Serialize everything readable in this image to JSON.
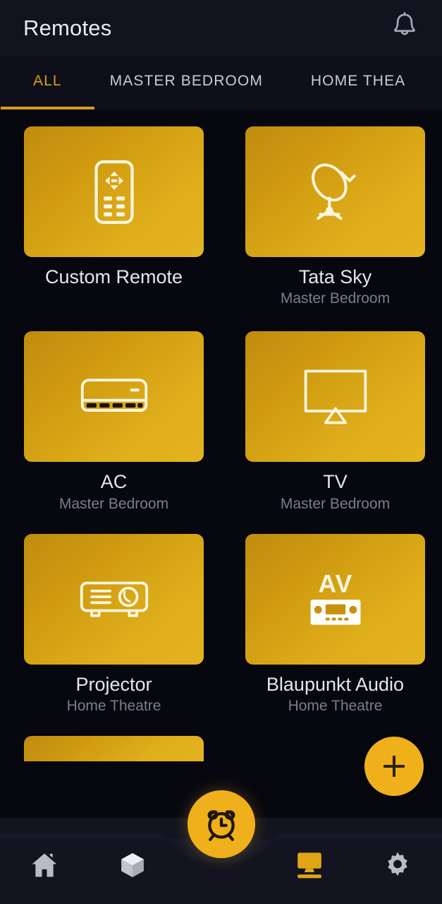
{
  "header": {
    "title": "Remotes",
    "notification_icon": "bell-icon"
  },
  "tabs": [
    {
      "label": "ALL",
      "active": true
    },
    {
      "label": "MASTER BEDROOM",
      "active": false
    },
    {
      "label": "HOME THEA",
      "active": false
    }
  ],
  "colors": {
    "accent": "#d99d18",
    "fab": "#efb01c",
    "card_gradient_start": "#c08c10",
    "card_gradient_end": "#e3b41f",
    "background": "#07070f",
    "header_bg": "#12131f",
    "nav_bg": "#13141f",
    "title_text": "#e4e6ef",
    "subtitle_text": "#7b7d8c",
    "nav_inactive": "#b9bbc6"
  },
  "remotes": [
    {
      "title": "Custom Remote",
      "room": "",
      "icon": "remote-control-icon"
    },
    {
      "title": "Tata Sky",
      "room": "Master Bedroom",
      "icon": "satellite-dish-icon"
    },
    {
      "title": "AC",
      "room": "Master Bedroom",
      "icon": "air-conditioner-icon"
    },
    {
      "title": "TV",
      "room": "Master Bedroom",
      "icon": "television-icon"
    },
    {
      "title": "Projector",
      "room": "Home Theatre",
      "icon": "projector-icon"
    },
    {
      "title": "Blaupunkt Audio",
      "room": "Home Theatre",
      "icon": "av-receiver-icon"
    }
  ],
  "av_icon_label": "AV",
  "add_button": {
    "label": "+",
    "icon": "plus-icon"
  },
  "bottom_nav": [
    {
      "icon": "home-icon",
      "active": false
    },
    {
      "icon": "cube-icon",
      "active": false
    },
    {
      "icon": "alarm-clock-icon",
      "active": false,
      "is_fab": true
    },
    {
      "icon": "monitor-remote-icon",
      "active": true
    },
    {
      "icon": "gear-icon",
      "active": false
    }
  ]
}
